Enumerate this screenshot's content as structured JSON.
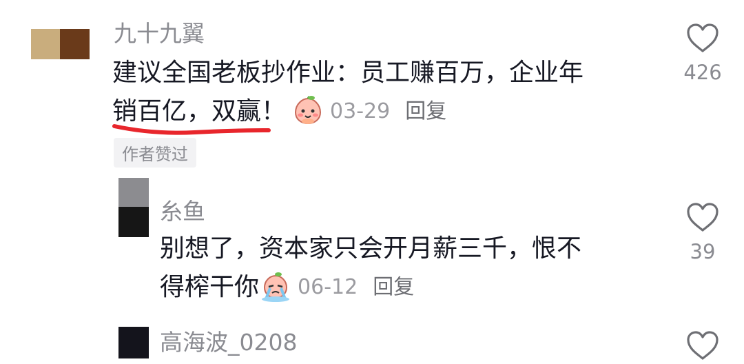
{
  "comments": [
    {
      "username": "九十九翼",
      "text_line1": "建议全国老板抄作业：员工赚百万，企业年",
      "text_line2": "销百亿，双赢！",
      "emoji": "blushing-peach-emoji",
      "date": "03-29",
      "reply_label": "回复",
      "badge": "作者赞过",
      "likes": "426",
      "like_icon": "heart-outline-icon"
    },
    {
      "username": "糸鱼",
      "text_line1": "别想了，资本家只会开月薪三千，恨不",
      "text_line2": "得榨干你",
      "emoji": "crying-peach-emoji",
      "date": "06-12",
      "reply_label": "回复",
      "likes": "39",
      "like_icon": "heart-outline-icon"
    },
    {
      "username": "高海波_0208",
      "like_icon": "heart-outline-icon"
    }
  ],
  "colors": {
    "text": "#161823",
    "username": "#8a8b91",
    "underline": "#e8262c"
  }
}
